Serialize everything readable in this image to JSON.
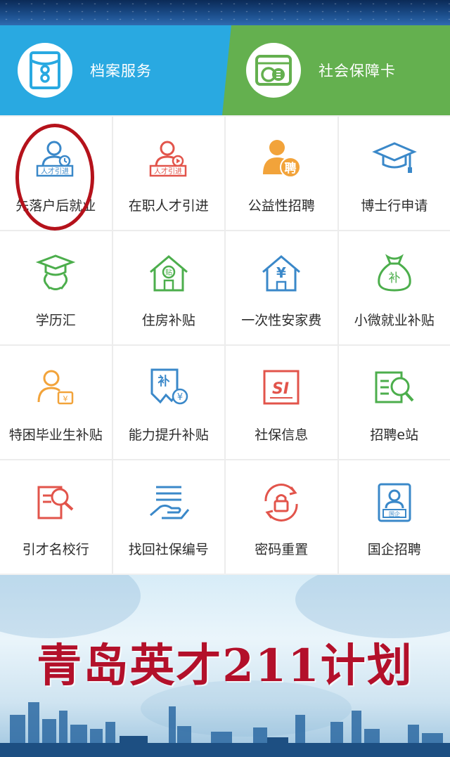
{
  "services": [
    {
      "id": "archive",
      "label": "档案服务",
      "icon": "archive-folder-icon"
    },
    {
      "id": "social-card",
      "label": "社会保障卡",
      "icon": "social-security-card-icon"
    }
  ],
  "grid": [
    {
      "label": "先落户后就业",
      "icon": "talent-intro-person-icon",
      "icon_badge": "人才引进"
    },
    {
      "label": "在职人才引进",
      "icon": "talent-intro-video-icon",
      "icon_badge": "人才引进"
    },
    {
      "label": "公益性招聘",
      "icon": "recruit-person-icon",
      "icon_badge": "聘"
    },
    {
      "label": "博士行申请",
      "icon": "graduation-cap-icon"
    },
    {
      "label": "学历汇",
      "icon": "graduate-person-icon"
    },
    {
      "label": "住房补贴",
      "icon": "house-subsidy-icon",
      "icon_badge": "贴"
    },
    {
      "label": "一次性安家费",
      "icon": "house-yuan-icon",
      "icon_badge": "¥"
    },
    {
      "label": "小微就业补贴",
      "icon": "money-bag-icon",
      "icon_badge": "补"
    },
    {
      "label": "特困毕业生补贴",
      "icon": "person-card-icon",
      "icon_badge": "¥"
    },
    {
      "label": "能力提升补贴",
      "icon": "subsidy-certificate-icon",
      "icon_badge": "补"
    },
    {
      "label": "社保信息",
      "icon": "social-insurance-icon",
      "icon_badge": "SI"
    },
    {
      "label": "招聘e站",
      "icon": "search-list-icon"
    },
    {
      "label": "引才名校行",
      "icon": "document-search-icon"
    },
    {
      "label": "找回社保编号",
      "icon": "hand-list-icon"
    },
    {
      "label": "密码重置",
      "icon": "lock-refresh-icon"
    },
    {
      "label": "国企招聘",
      "icon": "state-enterprise-icon",
      "icon_badge": "国企"
    }
  ],
  "banner": {
    "title": "青岛英才211计划"
  },
  "colors": {
    "archive_blue": "#29a9e1",
    "card_green": "#64b04f",
    "icon_blue": "#3a88c9",
    "icon_red": "#e2544b",
    "icon_green": "#4cae4c",
    "icon_orange": "#f2a33a",
    "banner_red": "#b3102a",
    "annotation_red": "#b5121b"
  }
}
